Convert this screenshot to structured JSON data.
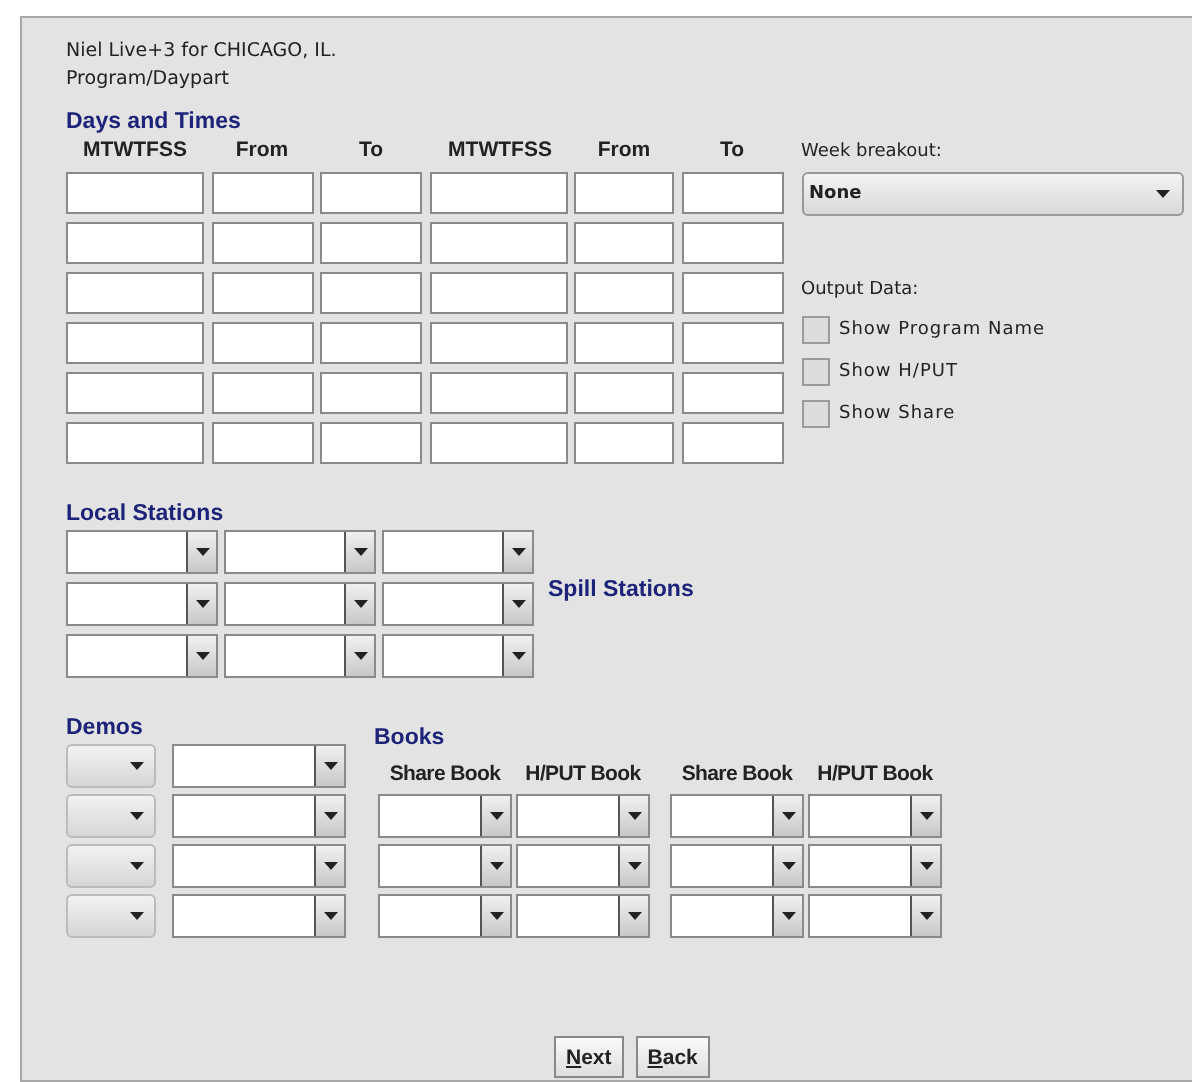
{
  "header": {
    "title": "Niel Live+3 for CHICAGO, IL.",
    "subtitle": "Program/Daypart"
  },
  "days_and_times": {
    "title": "Days and Times",
    "columns": [
      "MTWTFSS",
      "From",
      "To",
      "MTWTFSS",
      "From",
      "To"
    ],
    "rows": [
      {
        "kind": "entry-row"
      },
      {
        "kind": "entry-row"
      },
      {
        "kind": "entry-row"
      },
      {
        "kind": "entry-row"
      },
      {
        "kind": "entry-row"
      },
      {
        "kind": "entry-row"
      }
    ]
  },
  "week_breakout": {
    "label": "Week breakout:",
    "value": "None"
  },
  "output_data": {
    "label": "Output Data:",
    "options": [
      {
        "label": "Show Program Name",
        "checked": false
      },
      {
        "label": "Show H/PUT",
        "checked": false
      },
      {
        "label": "Show Share",
        "checked": false
      }
    ]
  },
  "local_stations": {
    "title": "Local Stations",
    "spill_label": "Spill Stations",
    "rows": [
      {
        "kind": "combo-row"
      },
      {
        "kind": "combo-row"
      },
      {
        "kind": "combo-row"
      }
    ]
  },
  "demos": {
    "title": "Demos",
    "rows": [
      {
        "kind": "demo-row"
      },
      {
        "kind": "demo-row"
      },
      {
        "kind": "demo-row"
      },
      {
        "kind": "demo-row"
      }
    ]
  },
  "books": {
    "title": "Books",
    "columns": [
      "Share Book",
      "H/PUT Book",
      "Share Book",
      "H/PUT Book"
    ],
    "rows": [
      {
        "kind": "combo-row"
      },
      {
        "kind": "combo-row"
      },
      {
        "kind": "combo-row"
      }
    ]
  },
  "buttons": [
    "Next",
    "Back"
  ]
}
